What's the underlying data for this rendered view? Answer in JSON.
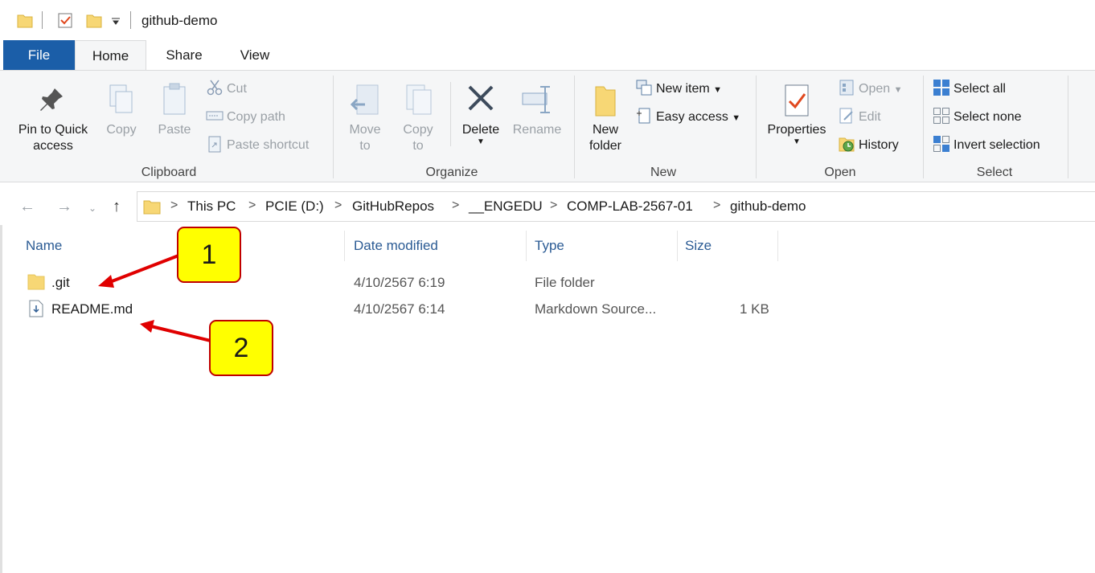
{
  "window": {
    "title": "github-demo"
  },
  "ribbon_tabs": [
    "File",
    "Home",
    "Share",
    "View"
  ],
  "clipboard": {
    "pin_label_1": "Pin to Quick",
    "pin_label_2": "access",
    "copy": "Copy",
    "paste": "Paste",
    "cut": "Cut",
    "copy_path": "Copy path",
    "paste_shortcut": "Paste shortcut",
    "group": "Clipboard"
  },
  "organize": {
    "move_1": "Move",
    "move_2": "to",
    "copy_1": "Copy",
    "copy_2": "to",
    "delete": "Delete",
    "rename": "Rename",
    "group": "Organize"
  },
  "new": {
    "new_folder_1": "New",
    "new_folder_2": "folder",
    "new_item": "New item",
    "easy_access": "Easy access",
    "group": "New"
  },
  "open": {
    "properties": "Properties",
    "open": "Open",
    "edit": "Edit",
    "history": "History",
    "group": "Open"
  },
  "select": {
    "select_all": "Select all",
    "select_none": "Select none",
    "invert": "Invert selection",
    "group": "Select"
  },
  "breadcrumb": [
    "This PC",
    "PCIE (D:)",
    "GitHubRepos",
    "__ENGEDU",
    "COMP-LAB-2567-01",
    "github-demo"
  ],
  "columns": {
    "name": "Name",
    "date": "Date modified",
    "type": "Type",
    "size": "Size"
  },
  "files": [
    {
      "name": ".git",
      "date": "4/10/2567 6:19",
      "type": "File folder",
      "size": ""
    },
    {
      "name": "README.md",
      "date": "4/10/2567 6:14",
      "type": "Markdown Source...",
      "size": "1 KB"
    }
  ],
  "callouts": [
    "1",
    "2"
  ],
  "colors": {
    "file_tab": "#1b5ea8",
    "callout_fill": "#ffff00",
    "callout_border": "#c00000",
    "arrow": "#e00000",
    "folder": "#f7d775"
  }
}
